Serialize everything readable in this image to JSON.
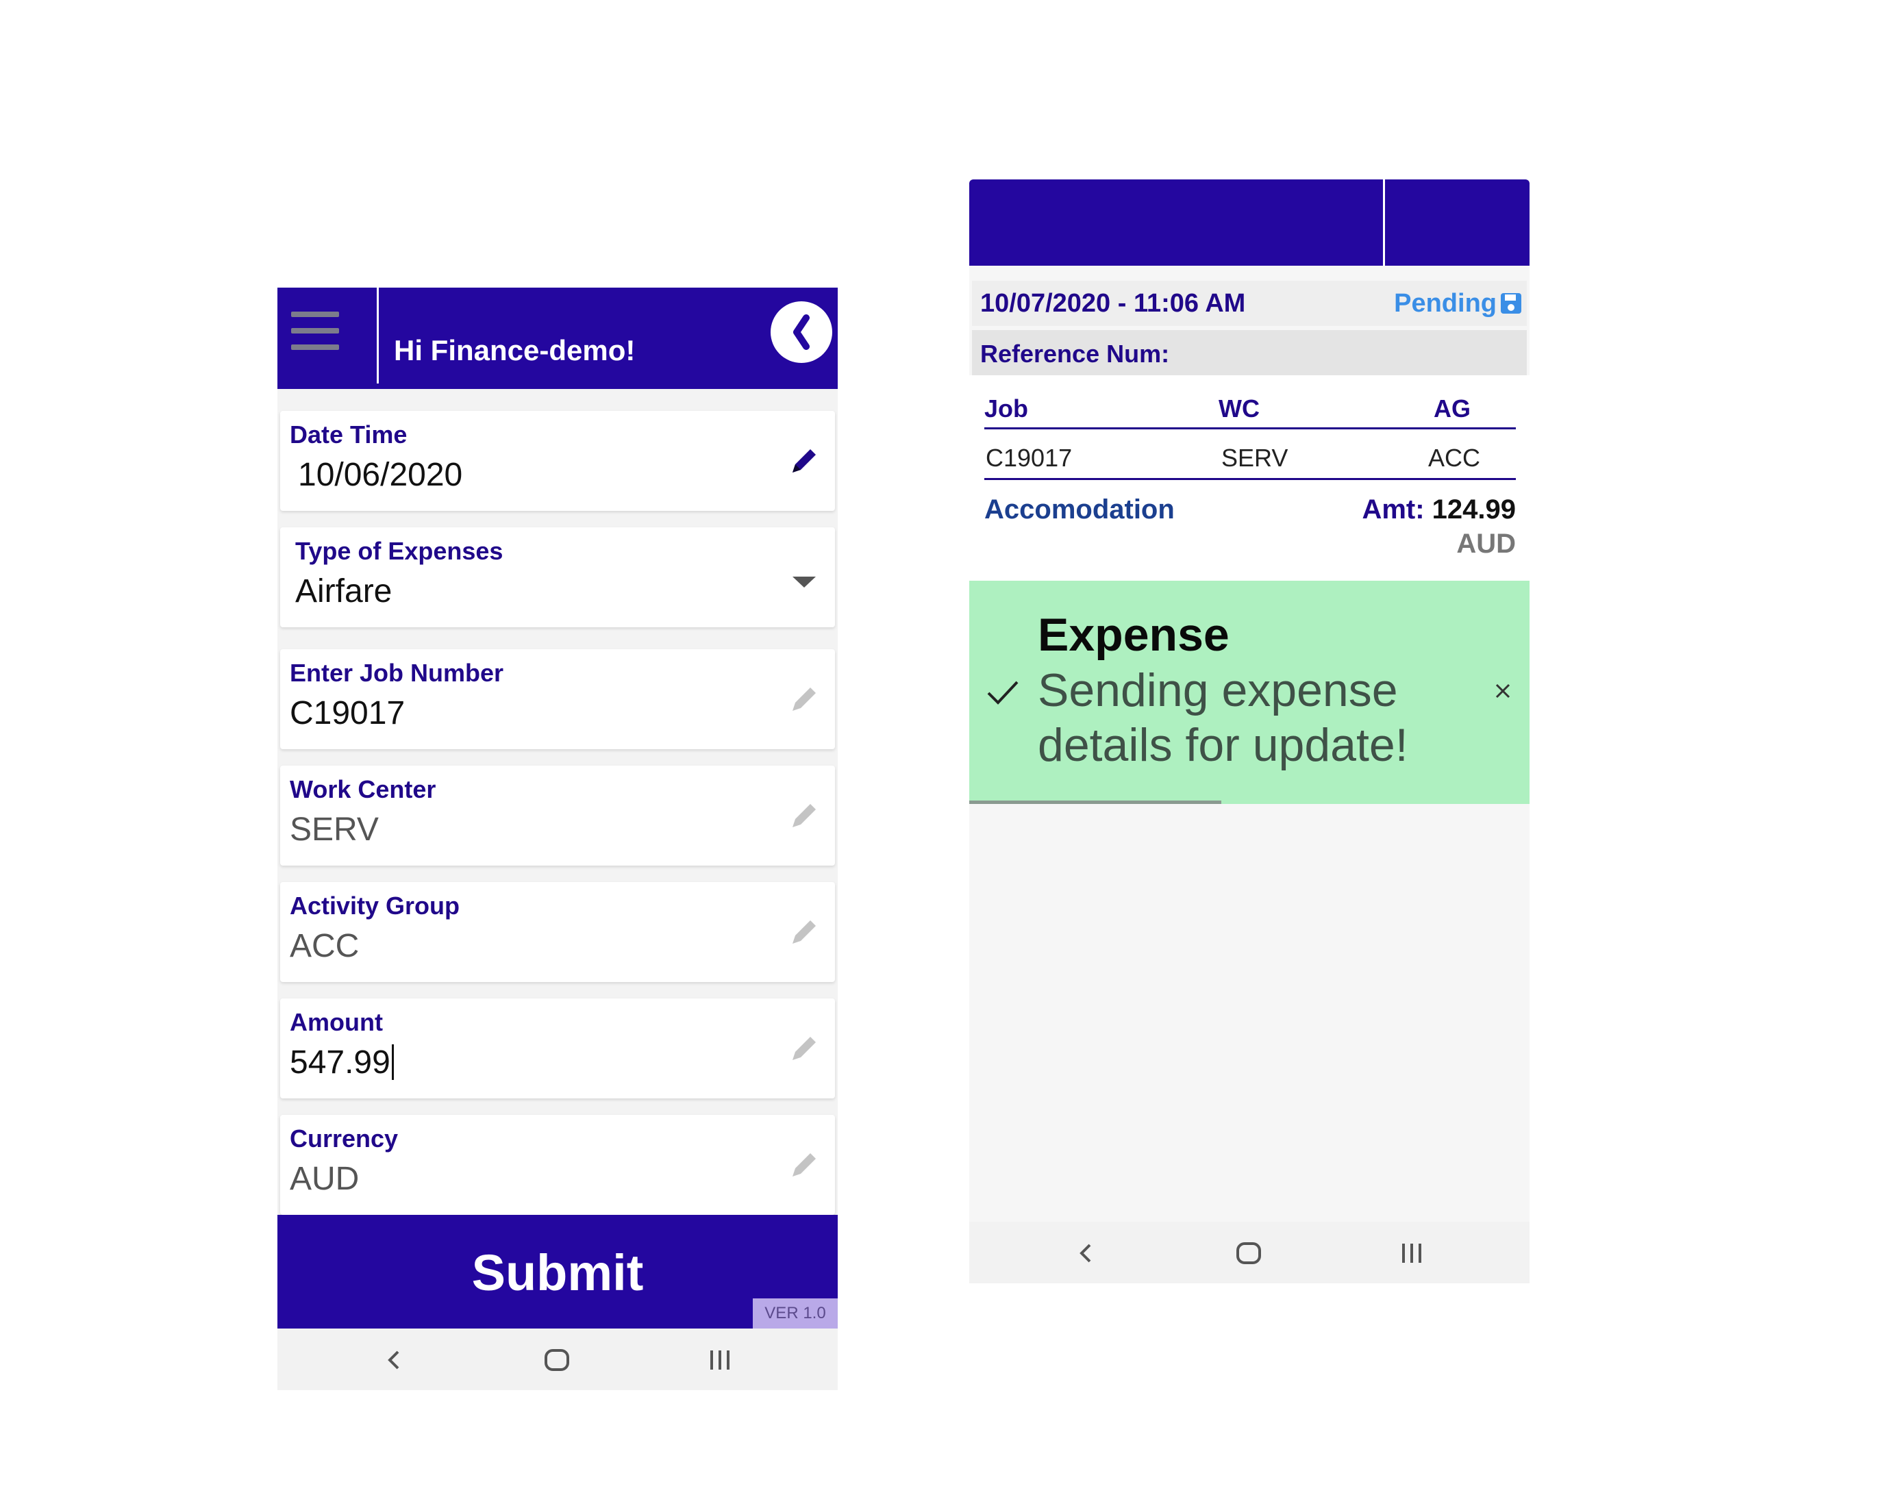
{
  "left": {
    "header": {
      "title": "Hi Finance-demo!"
    },
    "fields": [
      {
        "label": "Date Time",
        "value": "10/06/2020"
      },
      {
        "label": "Type of Expenses",
        "value": "Airfare"
      },
      {
        "label": "Enter Job Number",
        "value": "C19017"
      },
      {
        "label": "Work Center",
        "value": "SERV"
      },
      {
        "label": "Activity Group",
        "value": "ACC"
      },
      {
        "label": "Amount",
        "value": "547.99"
      },
      {
        "label": "Currency",
        "value": "AUD"
      }
    ],
    "submit_label": "Submit",
    "version": "VER 1.0"
  },
  "right": {
    "datetime": "10/07/2020 - 11:06 AM",
    "status": "Pending",
    "reference_label": "Reference Num:",
    "table": {
      "headers": [
        "Job",
        "WC",
        "AG"
      ],
      "row": [
        "C19017",
        "SERV",
        "ACC"
      ]
    },
    "expense_type": "Accomodation",
    "amount_label": "Amt:",
    "amount_value": "124.99",
    "currency": "AUD",
    "toast": {
      "title": "Expense",
      "message": "Sending expense details for update!"
    }
  },
  "colors": {
    "brand": "#24079f",
    "label": "#20088a",
    "status": "#3a8ee6",
    "toast": "#aef0c0"
  },
  "icons": [
    "menu-icon",
    "back-icon",
    "pencil-icon",
    "chevron-down-icon",
    "save-icon",
    "check-icon",
    "close-icon",
    "nav-back-icon",
    "nav-home-icon",
    "nav-recents-icon"
  ]
}
